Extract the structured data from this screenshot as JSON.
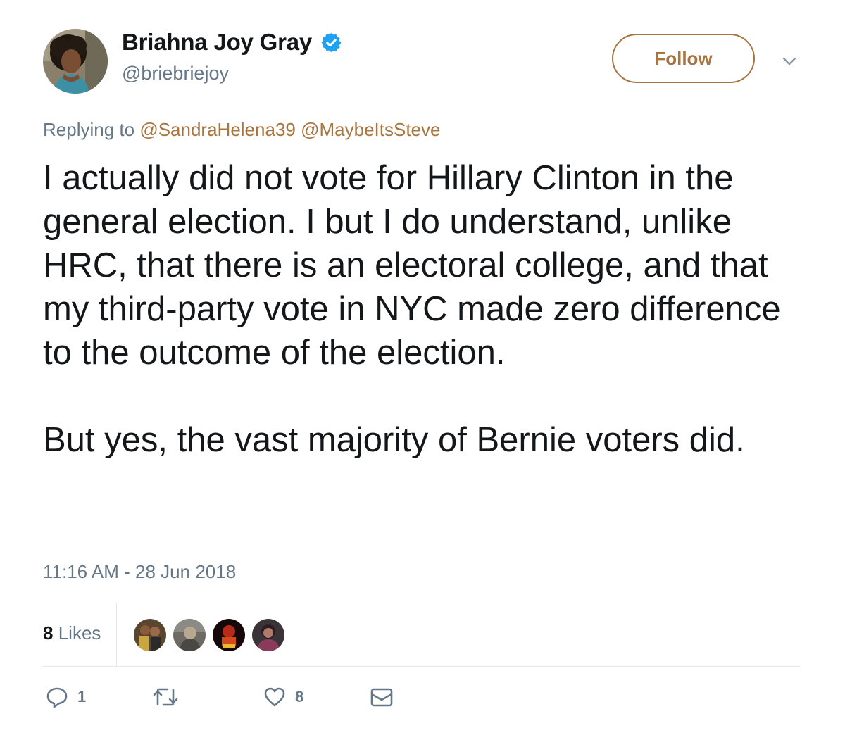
{
  "author": {
    "display_name": "Briahna Joy Gray",
    "handle": "@briebriejoy",
    "verified": true
  },
  "follow_label": "Follow",
  "reply_context": {
    "prefix": "Replying to",
    "mentions": [
      "@SandraHelena39",
      "@MaybeItsSteve"
    ]
  },
  "tweet": {
    "paragraphs": [
      "I actually did not vote for Hillary Clinton in the general election. I but I do understand, unlike HRC, that there is an electoral college, and that my third-party vote in NYC made zero difference to the outcome of the election.",
      "But yes, the vast majority of Bernie voters did."
    ],
    "timestamp": "11:16 AM - 28 Jun 2018"
  },
  "stats": {
    "likes_count": "8",
    "likes_label": "Likes",
    "liker_avatar_count": 4
  },
  "actions": {
    "reply_count": "1",
    "retweet_count": "",
    "like_count": "8"
  },
  "colors": {
    "accent": "#a8743f",
    "verified": "#1da1f2",
    "secondary_text": "#657786",
    "divider": "#e1e8ed"
  },
  "icons": [
    "verified-badge-icon",
    "chevron-down-icon",
    "reply-icon",
    "retweet-icon",
    "heart-icon",
    "envelope-icon"
  ]
}
